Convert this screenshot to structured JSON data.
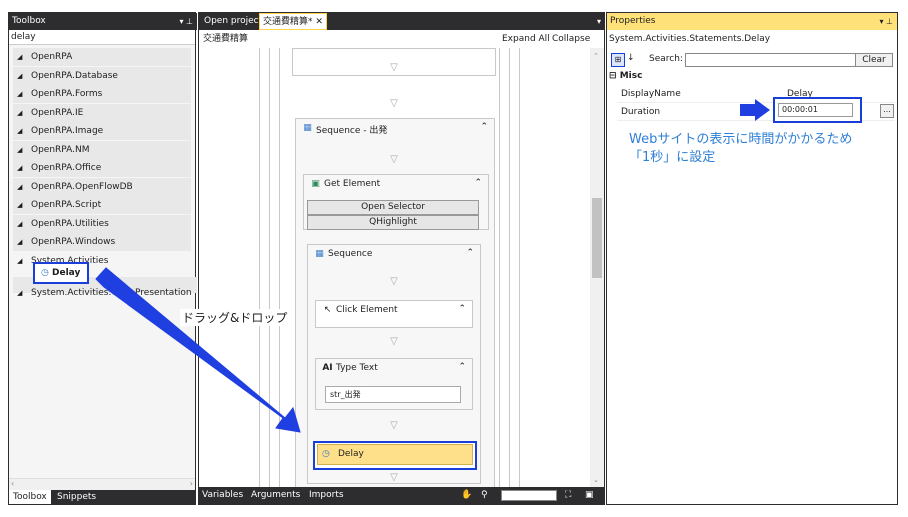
{
  "toolbox": {
    "title": "Toolbox",
    "search_value": "delay",
    "categories": [
      {
        "label": "OpenRPA"
      },
      {
        "label": "OpenRPA.Database"
      },
      {
        "label": "OpenRPA.Forms"
      },
      {
        "label": "OpenRPA.IE"
      },
      {
        "label": "OpenRPA.Image"
      },
      {
        "label": "OpenRPA.NM"
      },
      {
        "label": "OpenRPA.Office"
      },
      {
        "label": "OpenRPA.OpenFlowDB"
      },
      {
        "label": "OpenRPA.Script"
      },
      {
        "label": "OpenRPA.Utilities"
      },
      {
        "label": "OpenRPA.Windows"
      },
      {
        "label": "System.Activities"
      },
      {
        "label": "System.Activities.Core.Presentation"
      }
    ],
    "delay_item": "Delay",
    "tabs": [
      "Toolbox",
      "Snippets"
    ]
  },
  "designer": {
    "tabs": [
      "Open project",
      "交通費精算*"
    ],
    "close_glyph": "✕",
    "breadcrumb": "交通費精算",
    "expand_all": "Expand All",
    "collapse_all": "Collapse All",
    "footer": {
      "variables": "Variables",
      "arguments": "Arguments",
      "imports": "Imports"
    },
    "activities": {
      "sequence_outer": "Sequence - 出発",
      "get_element": "Get Element",
      "open_selector": "Open Selector",
      "highlight": "Highlight",
      "sequence_inner": "Sequence",
      "click_element": "Click Element",
      "type_text": "Type Text",
      "type_text_value": "str_出発",
      "delay": "Delay"
    }
  },
  "properties": {
    "title": "Properties",
    "type_name": "System.Activities.Statements.Delay",
    "search_label": "Search:",
    "clear_label": "Clear",
    "category": "Misc",
    "rows": [
      {
        "name": "DisplayName",
        "value": "Delay"
      },
      {
        "name": "Duration",
        "value": "00:00:01"
      }
    ],
    "ellipsis": "..."
  },
  "annotations": {
    "drag_drop": "ドラッグ&ドロップ",
    "note_line1": "Webサイトの表示に時間がかかるため",
    "note_line2": "「1秒」に設定"
  },
  "colors": {
    "highlight": "#1a3fd9",
    "arrow": "#1f3fe0",
    "delay_selected": "#ffe08a",
    "note_text": "#2e7fd6"
  }
}
